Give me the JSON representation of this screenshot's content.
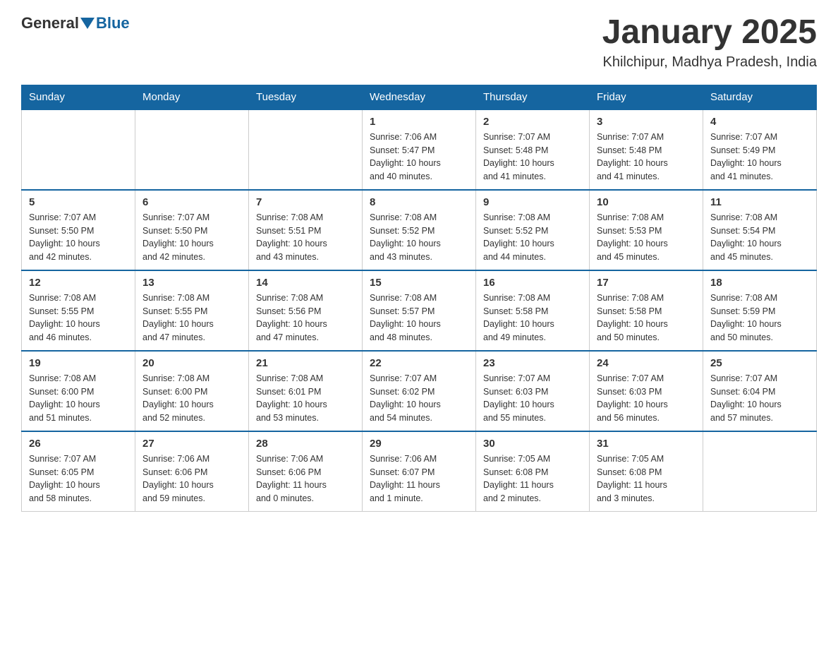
{
  "header": {
    "logo_general": "General",
    "logo_blue": "Blue",
    "month_title": "January 2025",
    "location": "Khilchipur, Madhya Pradesh, India"
  },
  "weekdays": [
    "Sunday",
    "Monday",
    "Tuesday",
    "Wednesday",
    "Thursday",
    "Friday",
    "Saturday"
  ],
  "weeks": [
    [
      {
        "day": "",
        "info": ""
      },
      {
        "day": "",
        "info": ""
      },
      {
        "day": "",
        "info": ""
      },
      {
        "day": "1",
        "info": "Sunrise: 7:06 AM\nSunset: 5:47 PM\nDaylight: 10 hours\nand 40 minutes."
      },
      {
        "day": "2",
        "info": "Sunrise: 7:07 AM\nSunset: 5:48 PM\nDaylight: 10 hours\nand 41 minutes."
      },
      {
        "day": "3",
        "info": "Sunrise: 7:07 AM\nSunset: 5:48 PM\nDaylight: 10 hours\nand 41 minutes."
      },
      {
        "day": "4",
        "info": "Sunrise: 7:07 AM\nSunset: 5:49 PM\nDaylight: 10 hours\nand 41 minutes."
      }
    ],
    [
      {
        "day": "5",
        "info": "Sunrise: 7:07 AM\nSunset: 5:50 PM\nDaylight: 10 hours\nand 42 minutes."
      },
      {
        "day": "6",
        "info": "Sunrise: 7:07 AM\nSunset: 5:50 PM\nDaylight: 10 hours\nand 42 minutes."
      },
      {
        "day": "7",
        "info": "Sunrise: 7:08 AM\nSunset: 5:51 PM\nDaylight: 10 hours\nand 43 minutes."
      },
      {
        "day": "8",
        "info": "Sunrise: 7:08 AM\nSunset: 5:52 PM\nDaylight: 10 hours\nand 43 minutes."
      },
      {
        "day": "9",
        "info": "Sunrise: 7:08 AM\nSunset: 5:52 PM\nDaylight: 10 hours\nand 44 minutes."
      },
      {
        "day": "10",
        "info": "Sunrise: 7:08 AM\nSunset: 5:53 PM\nDaylight: 10 hours\nand 45 minutes."
      },
      {
        "day": "11",
        "info": "Sunrise: 7:08 AM\nSunset: 5:54 PM\nDaylight: 10 hours\nand 45 minutes."
      }
    ],
    [
      {
        "day": "12",
        "info": "Sunrise: 7:08 AM\nSunset: 5:55 PM\nDaylight: 10 hours\nand 46 minutes."
      },
      {
        "day": "13",
        "info": "Sunrise: 7:08 AM\nSunset: 5:55 PM\nDaylight: 10 hours\nand 47 minutes."
      },
      {
        "day": "14",
        "info": "Sunrise: 7:08 AM\nSunset: 5:56 PM\nDaylight: 10 hours\nand 47 minutes."
      },
      {
        "day": "15",
        "info": "Sunrise: 7:08 AM\nSunset: 5:57 PM\nDaylight: 10 hours\nand 48 minutes."
      },
      {
        "day": "16",
        "info": "Sunrise: 7:08 AM\nSunset: 5:58 PM\nDaylight: 10 hours\nand 49 minutes."
      },
      {
        "day": "17",
        "info": "Sunrise: 7:08 AM\nSunset: 5:58 PM\nDaylight: 10 hours\nand 50 minutes."
      },
      {
        "day": "18",
        "info": "Sunrise: 7:08 AM\nSunset: 5:59 PM\nDaylight: 10 hours\nand 50 minutes."
      }
    ],
    [
      {
        "day": "19",
        "info": "Sunrise: 7:08 AM\nSunset: 6:00 PM\nDaylight: 10 hours\nand 51 minutes."
      },
      {
        "day": "20",
        "info": "Sunrise: 7:08 AM\nSunset: 6:00 PM\nDaylight: 10 hours\nand 52 minutes."
      },
      {
        "day": "21",
        "info": "Sunrise: 7:08 AM\nSunset: 6:01 PM\nDaylight: 10 hours\nand 53 minutes."
      },
      {
        "day": "22",
        "info": "Sunrise: 7:07 AM\nSunset: 6:02 PM\nDaylight: 10 hours\nand 54 minutes."
      },
      {
        "day": "23",
        "info": "Sunrise: 7:07 AM\nSunset: 6:03 PM\nDaylight: 10 hours\nand 55 minutes."
      },
      {
        "day": "24",
        "info": "Sunrise: 7:07 AM\nSunset: 6:03 PM\nDaylight: 10 hours\nand 56 minutes."
      },
      {
        "day": "25",
        "info": "Sunrise: 7:07 AM\nSunset: 6:04 PM\nDaylight: 10 hours\nand 57 minutes."
      }
    ],
    [
      {
        "day": "26",
        "info": "Sunrise: 7:07 AM\nSunset: 6:05 PM\nDaylight: 10 hours\nand 58 minutes."
      },
      {
        "day": "27",
        "info": "Sunrise: 7:06 AM\nSunset: 6:06 PM\nDaylight: 10 hours\nand 59 minutes."
      },
      {
        "day": "28",
        "info": "Sunrise: 7:06 AM\nSunset: 6:06 PM\nDaylight: 11 hours\nand 0 minutes."
      },
      {
        "day": "29",
        "info": "Sunrise: 7:06 AM\nSunset: 6:07 PM\nDaylight: 11 hours\nand 1 minute."
      },
      {
        "day": "30",
        "info": "Sunrise: 7:05 AM\nSunset: 6:08 PM\nDaylight: 11 hours\nand 2 minutes."
      },
      {
        "day": "31",
        "info": "Sunrise: 7:05 AM\nSunset: 6:08 PM\nDaylight: 11 hours\nand 3 minutes."
      },
      {
        "day": "",
        "info": ""
      }
    ]
  ]
}
